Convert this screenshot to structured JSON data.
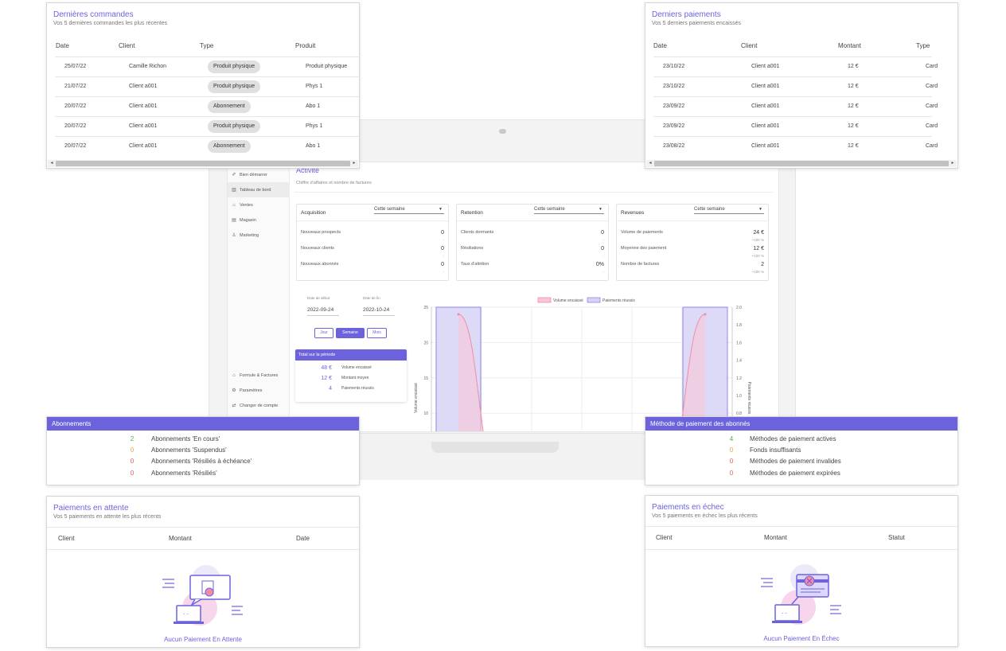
{
  "dashboard": {
    "sidebar": {
      "top_items": [
        {
          "icon": "rocket-icon",
          "glyph": "✐",
          "label": "Bien démarrer"
        },
        {
          "icon": "bar-chart-icon",
          "glyph": "▥",
          "label": "Tableau de bord"
        },
        {
          "icon": "tag-icon",
          "glyph": "⌂",
          "label": "Ventes"
        },
        {
          "icon": "store-icon",
          "glyph": "▤",
          "label": "Magasin"
        },
        {
          "icon": "person-icon",
          "glyph": "♙",
          "label": "Marketing"
        }
      ],
      "bottom_items": [
        {
          "icon": "tag-icon",
          "glyph": "⌂",
          "label": "Formule & Factures"
        },
        {
          "icon": "gear-icon",
          "glyph": "⚙",
          "label": "Paramètres"
        },
        {
          "icon": "switch-icon",
          "glyph": "⇄",
          "label": "Changer de compte"
        }
      ]
    },
    "title": "Activité",
    "subtitle": "Chiffre d'affaires et nombre de factures",
    "kpis": [
      {
        "title": "Acquisition",
        "period": "Cette semaine",
        "rows": [
          {
            "label": "Nouveaux prospects",
            "value": "0",
            "pct": "-"
          },
          {
            "label": "Nouveaux clients",
            "value": "0",
            "pct": "-"
          },
          {
            "label": "Nouveaux abonnés",
            "value": "0",
            "pct": "-"
          }
        ]
      },
      {
        "title": "Retention",
        "period": "Cette semaine",
        "rows": [
          {
            "label": "Clients dormants",
            "value": "0",
            "pct": "-"
          },
          {
            "label": "Résiliations",
            "value": "0",
            "pct": "-"
          },
          {
            "label": "Taux d'attrition",
            "value": "0%",
            "pct": "-"
          }
        ]
      },
      {
        "title": "Revenues",
        "period": "Cette semaine",
        "rows": [
          {
            "label": "Volume de paiements",
            "value": "24 €",
            "pct": "+100 %"
          },
          {
            "label": "Moyenne des paiement",
            "value": "12 €",
            "pct": "+100 %"
          },
          {
            "label": "Nombre de factures",
            "value": "2",
            "pct": "+100 %"
          }
        ]
      }
    ],
    "dates": {
      "start_label": "Date de début",
      "start": "2022-09-24",
      "end_label": "Date de fin",
      "end": "2022-10-24"
    },
    "period_buttons": {
      "day": "Jour",
      "week": "Semaine",
      "month": "Mois"
    },
    "total": {
      "title": "Total sur la période",
      "rows": [
        {
          "value": "48 €",
          "label": "Volume encaissé"
        },
        {
          "value": "12 €",
          "label": "Montant moyen"
        },
        {
          "value": "4",
          "label": "Paiements réussis"
        }
      ]
    }
  },
  "chart_data": {
    "type": "area",
    "legend": [
      "Volume encaissé",
      "Paiements réussis"
    ],
    "legend_position": "top",
    "ylabel": "Volume encaissé",
    "y2label": "Paiements réussis",
    "y_ticks": [
      "25",
      "20",
      "15",
      "10"
    ],
    "y2_ticks": [
      "2.0",
      "1.8",
      "1.6",
      "1.4",
      "1.2",
      "1.0",
      "0.8"
    ],
    "ylim": [
      0,
      25
    ],
    "y2lim": [
      0,
      2.0
    ],
    "series": [
      {
        "name": "Volume encaissé",
        "color": "#f48aa7",
        "values": [
          24,
          0,
          0,
          0,
          0,
          0,
          24
        ]
      },
      {
        "name": "Paiements réussis",
        "color": "#a9a3ec",
        "values": [
          2,
          0,
          0,
          0,
          0,
          0,
          2
        ]
      }
    ],
    "grid": true
  },
  "orders": {
    "title": "Dernières commandes",
    "subtitle": "Vos 5 dernières commandes les plus récentes",
    "headers": [
      "Date",
      "Client",
      "Type",
      "Produit"
    ],
    "rows": [
      {
        "date": "25/07/22",
        "client": "Camille Richon",
        "type": "Produit physique",
        "product": "Produit physique"
      },
      {
        "date": "21/07/22",
        "client": "Client a001",
        "type": "Produit physique",
        "product": "Phys 1"
      },
      {
        "date": "20/07/22",
        "client": "Client a001",
        "type": "Abonnement",
        "product": "Abo 1"
      },
      {
        "date": "20/07/22",
        "client": "Client a001",
        "type": "Produit physique",
        "product": "Phys 1"
      },
      {
        "date": "20/07/22",
        "client": "Client a001",
        "type": "Abonnement",
        "product": "Abo 1"
      }
    ]
  },
  "payments": {
    "title": "Derniers paiements",
    "subtitle": "Vos 5 derniers paiements encaissés",
    "headers": [
      "Date",
      "Client",
      "Montant",
      "Type"
    ],
    "rows": [
      {
        "date": "23/10/22",
        "client": "Client a001",
        "amount": "12 €",
        "type": "Card"
      },
      {
        "date": "23/10/22",
        "client": "Client a001",
        "amount": "12 €",
        "type": "Card"
      },
      {
        "date": "23/09/22",
        "client": "Client a001",
        "amount": "12 €",
        "type": "Card"
      },
      {
        "date": "23/09/22",
        "client": "Client a001",
        "amount": "12 €",
        "type": "Card"
      },
      {
        "date": "23/08/22",
        "client": "Client a001",
        "amount": "12 €",
        "type": "Card"
      }
    ]
  },
  "subscriptions": {
    "title": "Abonnements",
    "rows": [
      {
        "count": "2",
        "label": "Abonnements 'En cours'",
        "color": "#4caf50"
      },
      {
        "count": "0",
        "label": "Abonnements 'Suspendus'",
        "color": "#f0a04b"
      },
      {
        "count": "0",
        "label": "Abonnements 'Résiliés à échéance'",
        "color": "#e55b5b"
      },
      {
        "count": "0",
        "label": "Abonnements 'Résiliés'",
        "color": "#e55b5b"
      }
    ]
  },
  "payment_methods": {
    "title": "Méthode de paiement des abonnés",
    "rows": [
      {
        "count": "4",
        "label": "Méthodes de paiement actives",
        "color": "#4caf50"
      },
      {
        "count": "0",
        "label": "Fonds insuffisants",
        "color": "#f0a04b"
      },
      {
        "count": "0",
        "label": "Méthodes de paiement invalides",
        "color": "#e55b5b"
      },
      {
        "count": "0",
        "label": "Méthodes de paiement expirées",
        "color": "#e55b5b"
      }
    ]
  },
  "pending": {
    "title": "Paiements en attente",
    "subtitle": "Vos 5 paiements en attente les plus récents",
    "headers": [
      "Client",
      "Montant",
      "Date"
    ],
    "empty": "Aucun Paiement En Attente"
  },
  "failed": {
    "title": "Paiements en échec",
    "subtitle": "Vos 5 paiements en échec les plus récents",
    "headers": [
      "Client",
      "Montant",
      "Statut"
    ],
    "empty": "Aucun Paiement En Échec"
  },
  "colors": {
    "accent": "#6c63dc",
    "green": "#4caf50",
    "orange": "#f0a04b",
    "red": "#e55b5b"
  }
}
